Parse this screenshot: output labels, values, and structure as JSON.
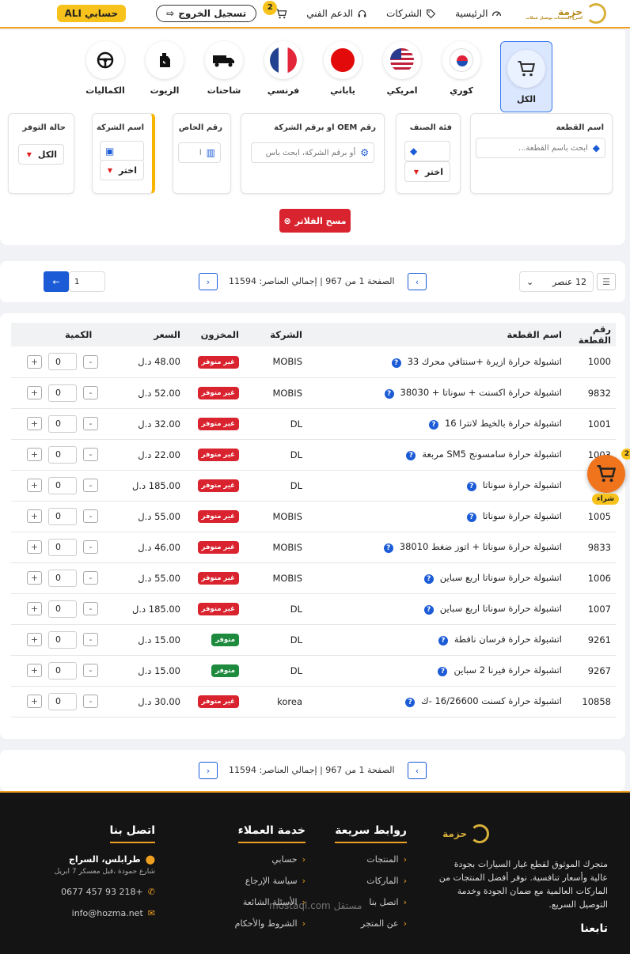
{
  "header": {
    "brand_name": "حزمة",
    "brand_tagline": "اسرع الشحنات توصيل عملات",
    "nav": [
      "الرئيسية",
      "الشركات",
      "الدعم الفني"
    ],
    "cart_count": "2",
    "logout_label": "تسجيل الخروج",
    "account_label": "حسابي ALI"
  },
  "categories": [
    {
      "label": "الكل",
      "icon": "cart-icon",
      "active": true
    },
    {
      "label": "كوري",
      "icon": "korea-flag-icon"
    },
    {
      "label": "امريكي",
      "icon": "usa-flag-icon"
    },
    {
      "label": "ياباني",
      "icon": "japan-flag-icon"
    },
    {
      "label": "فرنسي",
      "icon": "france-flag-icon"
    },
    {
      "label": "شاحنات",
      "icon": "truck-icon"
    },
    {
      "label": "الزيوت",
      "icon": "oil-icon"
    },
    {
      "label": "الكماليات",
      "icon": "steering-wheel-icon"
    }
  ],
  "filters": {
    "part_name": {
      "label": "اسم القطعة",
      "placeholder": "ابحث باسم القطعة..."
    },
    "category": {
      "label": "فئة الصنف",
      "value": "اختر"
    },
    "oem": {
      "label": "رقم OEM او برقم الشركة",
      "placeholder": "أو برقم الشركة، ابحث باس"
    },
    "special_no": {
      "label": "رقم الخاص",
      "placeholder": "ا"
    },
    "company": {
      "label": "اسم الشركة",
      "value": "اختر"
    },
    "availability": {
      "label": "حالة التوفر",
      "value": "الكل"
    },
    "clear_label": "مسح الفلاتر"
  },
  "pagination": {
    "per_page": "12 عنصر",
    "info": "الصفحة 1 من 967 | إجمالي العناصر: 11594",
    "goto_value": "1"
  },
  "table": {
    "headers": [
      "رقم القطعة",
      "اسم القطعة",
      "الشركة",
      "المخزون",
      "السعر",
      "الكمية"
    ],
    "rows": [
      {
        "no": "1000",
        "name": "اتشبولة حرارة ازيرة +سنتافي محرك 33",
        "company": "MOBIS",
        "stock": "غير متوفر",
        "price": "48.00 د.ل",
        "qty": "0"
      },
      {
        "no": "9832",
        "name": "اتشبولة حرارة اكسنت + سوناتا + 38030",
        "company": "MOBIS",
        "stock": "غير متوفر",
        "price": "52.00 د.ل",
        "qty": "0"
      },
      {
        "no": "1001",
        "name": "اتشبولة حرارة بالخيط لانترا 16",
        "company": "DL",
        "stock": "غير متوفر",
        "price": "32.00 د.ل",
        "qty": "0"
      },
      {
        "no": "1003",
        "name": "اتشبولة حرارة سامسونج SM5 مربعة",
        "company": "DL",
        "stock": "غير متوفر",
        "price": "22.00 د.ل",
        "qty": "0"
      },
      {
        "no": "1",
        "name": "اتشبولة حرارة سوناتا",
        "company": "DL",
        "stock": "غير متوفر",
        "price": "185.00 د.ل",
        "qty": "0"
      },
      {
        "no": "1005",
        "name": "اتشبولة حرارة سوناتا",
        "company": "MOBIS",
        "stock": "غير متوفر",
        "price": "55.00 د.ل",
        "qty": "0"
      },
      {
        "no": "9833",
        "name": "اتشبولة حرارة سوناتا + اتوز ضغط 38010",
        "company": "MOBIS",
        "stock": "غير متوفر",
        "price": "46.00 د.ل",
        "qty": "0"
      },
      {
        "no": "1006",
        "name": "اتشبولة حرارة سوناتا اربع سباين",
        "company": "MOBIS",
        "stock": "غير متوفر",
        "price": "55.00 د.ل",
        "qty": "0"
      },
      {
        "no": "1007",
        "name": "اتشبولة حرارة سوناتا اربع سباين",
        "company": "DL",
        "stock": "غير متوفر",
        "price": "185.00 د.ل",
        "qty": "0"
      },
      {
        "no": "9261",
        "name": "اتشبولة حرارة فرسان نافطة",
        "company": "DL",
        "stock": "متوفر",
        "price": "15.00 د.ل",
        "qty": "0"
      },
      {
        "no": "9267",
        "name": "اتشبولة حرارة فيرنا 2 سباين",
        "company": "DL",
        "stock": "متوفر",
        "price": "15.00 د.ل",
        "qty": "0"
      },
      {
        "no": "10858",
        "name": "اتشبولة حرارة كسنت 16/26600 -ك",
        "company": "korea",
        "stock": "غير متوفر",
        "price": "30.00 د.ل",
        "qty": "0"
      }
    ]
  },
  "floating_cart": {
    "count": "2",
    "buy_label": "شراء"
  },
  "footer": {
    "about": "متجرك الموثوق لقطع غيار السيارات بجودة عالية وأسعار تنافسية. نوفر أفضل المنتجات من الماركات العالمية مع ضمان الجودة وخدمة التوصيل السريع.",
    "follow_label": "تابعنا",
    "quick_links": {
      "title": "روابط سريعة",
      "items": [
        "المنتجات",
        "الماركات",
        "اتصل بنا",
        "عن المتجر"
      ]
    },
    "customer_service": {
      "title": "خدمة العملاء",
      "items": [
        "حسابي",
        "سياسة الإرجاع",
        "الأسئلة الشائعة",
        "الشروط والأحكام"
      ]
    },
    "contact": {
      "title": "اتصل بنا",
      "city": "طرابلس، السراج",
      "address": "شارع حمودة ،قبل معسكر 7 ابريل",
      "phone": "0677 457 93 218+",
      "email": "info@hozma.net"
    },
    "watermark": "مستقل mostaql.com"
  }
}
